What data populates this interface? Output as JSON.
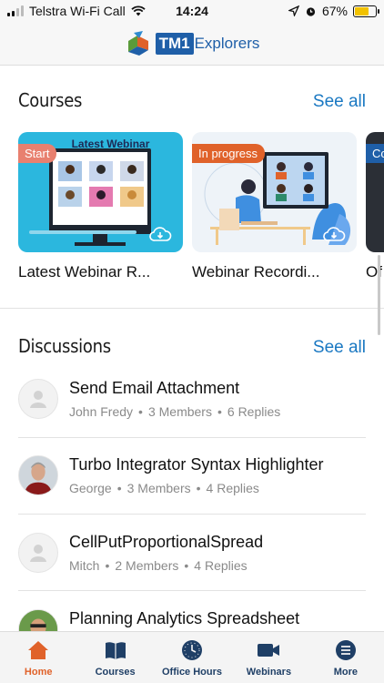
{
  "status_bar": {
    "carrier": "Telstra Wi-Fi Call",
    "time": "14:24",
    "battery_percent": "67%",
    "battery_level": 0.67
  },
  "header": {
    "logo_badge": "TM1",
    "logo_text": "Explorers"
  },
  "courses": {
    "title": "Courses",
    "see_all": "See all",
    "items": [
      {
        "pill": "Start",
        "pill_color": "#e8806f",
        "thumb_heading": "Latest Webinar",
        "title": "Latest Webinar R..."
      },
      {
        "pill": "In progress",
        "pill_color": "#e0622a",
        "title": "Webinar Recordi..."
      },
      {
        "pill": "Co",
        "pill_color": "#1f5fa8",
        "title": "Of"
      }
    ]
  },
  "discussions": {
    "title": "Discussions",
    "see_all": "See all",
    "items": [
      {
        "title": "Send Email Attachment",
        "author": "John Fredy",
        "members": "3 Members",
        "replies": "6 Replies",
        "avatar": "placeholder-avatar"
      },
      {
        "title": "Turbo Integrator Syntax Highlighter",
        "author": "George",
        "members": "3 Members",
        "replies": "4 Replies",
        "avatar": "photo-avatar"
      },
      {
        "title": "CellPutProportionalSpread",
        "author": "Mitch",
        "members": "2 Members",
        "replies": "4 Replies",
        "avatar": "placeholder-avatar"
      },
      {
        "title": "Planning Analytics Spreadsheet",
        "avatar": "photo-avatar"
      }
    ]
  },
  "tabs": [
    {
      "label": "Home",
      "icon": "home-icon",
      "active": true
    },
    {
      "label": "Courses",
      "icon": "courses-icon",
      "active": false
    },
    {
      "label": "Office Hours",
      "icon": "clock-icon",
      "active": false
    },
    {
      "label": "Webinars",
      "icon": "video-icon",
      "active": false
    },
    {
      "label": "More",
      "icon": "list-icon",
      "active": false
    }
  ],
  "colors": {
    "accent": "#1a78c2",
    "brand": "#1f5fa8",
    "active_tab": "#e0622a",
    "tab_inactive": "#1f3f66"
  }
}
